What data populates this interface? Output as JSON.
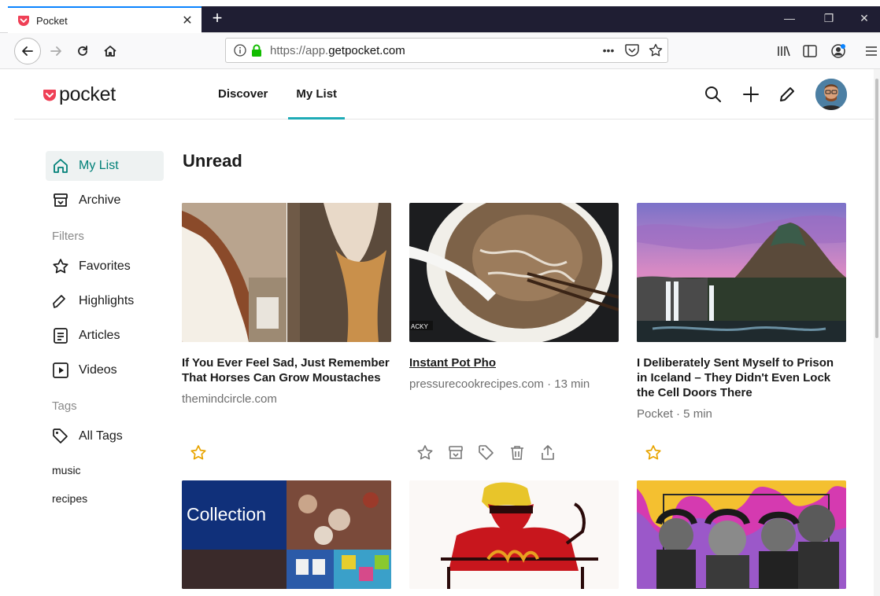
{
  "browser": {
    "tab_title": "Pocket",
    "url_prefix": "https://app.",
    "url_domain": "getpocket.com",
    "url_suffix": ".com",
    "url_ellipsis": "•••"
  },
  "app": {
    "logo_text": "pocket",
    "nav": [
      "Discover",
      "My List"
    ],
    "active_nav": "My List",
    "accent_color": "#1eabb6",
    "brand_color": "#ef4056"
  },
  "sidebar": {
    "items": [
      {
        "label": "My List",
        "icon": "home-icon"
      },
      {
        "label": "Archive",
        "icon": "archive-icon"
      }
    ],
    "filters_heading": "Filters",
    "filters": [
      {
        "label": "Favorites",
        "icon": "star-icon"
      },
      {
        "label": "Highlights",
        "icon": "highlighter-icon"
      },
      {
        "label": "Articles",
        "icon": "article-icon"
      },
      {
        "label": "Videos",
        "icon": "video-icon"
      }
    ],
    "tags_heading": "Tags",
    "all_tags": "All Tags",
    "tags": [
      "music",
      "recipes"
    ]
  },
  "main": {
    "heading": "Unread",
    "cards": [
      {
        "title": "If You Ever Feel Sad, Just Remember That Horses Can Grow Moustaches",
        "meta": "themindcircle.com"
      },
      {
        "title": "Instant Pot Pho",
        "meta": "pressurecookrecipes.com · 13 min"
      },
      {
        "title": "I Deliberately Sent Myself to Prison in Iceland – They Didn't Even Lock the Cell Doors There",
        "meta": "Pocket · 5 min"
      }
    ],
    "collection_label": "Collection"
  }
}
